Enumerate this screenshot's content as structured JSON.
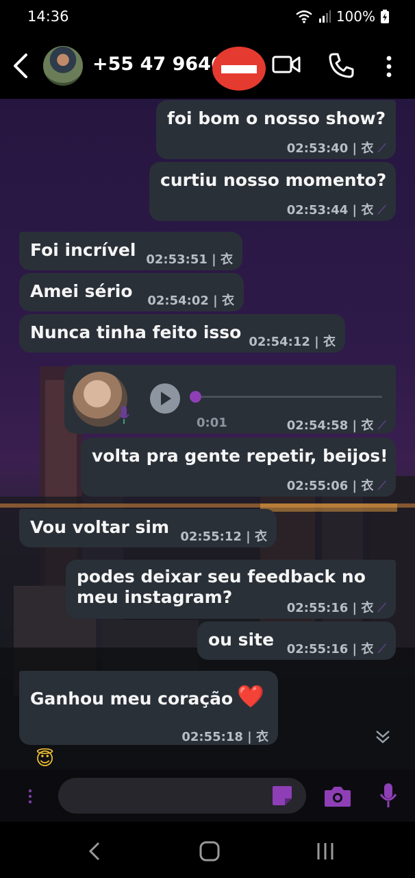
{
  "status": {
    "time": "14:36",
    "battery": "100%"
  },
  "header": {
    "contact_name": "+55 47 9646-"
  },
  "messages": [
    {
      "text": "foi bom o nosso show?",
      "time": "02:53:40 | 衣"
    },
    {
      "text": "curtiu nosso momento?",
      "time": "02:53:44 | 衣"
    },
    {
      "text": "Foi incrível",
      "time": "02:53:51 | 衣"
    },
    {
      "text": "Amei sério",
      "time": "02:54:02 | 衣"
    },
    {
      "text": "Nunca tinha feito isso",
      "time": "02:54:12 | 衣"
    },
    {
      "text": "",
      "time": "02:54:58 | 衣",
      "duration": "0:01"
    },
    {
      "text": "volta pra gente repetir, beijos!",
      "time": "02:55:06 | 衣"
    },
    {
      "text": "Vou voltar sim",
      "time": "02:55:12 | 衣"
    },
    {
      "text_line1": "podes deixar seu feedback no",
      "text_line2": "meu instagram?",
      "time": "02:55:16 | 衣"
    },
    {
      "text": "ou site",
      "time": "02:55:16 | 衣"
    },
    {
      "text": "Ganhou meu coração",
      "time": "02:55:18 | 衣",
      "emoji": "❤️"
    }
  ],
  "reaction_emoji": "😇",
  "colors": {
    "bubble": "#2a3038",
    "accent": "#8e3fb6",
    "attach_red": "#e53a2f"
  },
  "icons": [
    "back-arrow-icon",
    "video-call-icon",
    "phone-call-icon",
    "more-options-icon",
    "play-icon",
    "microphone-icon",
    "scroll-down-icon",
    "sticker-icon",
    "camera-icon",
    "nav-back-icon",
    "nav-home-icon",
    "nav-recents-icon"
  ]
}
